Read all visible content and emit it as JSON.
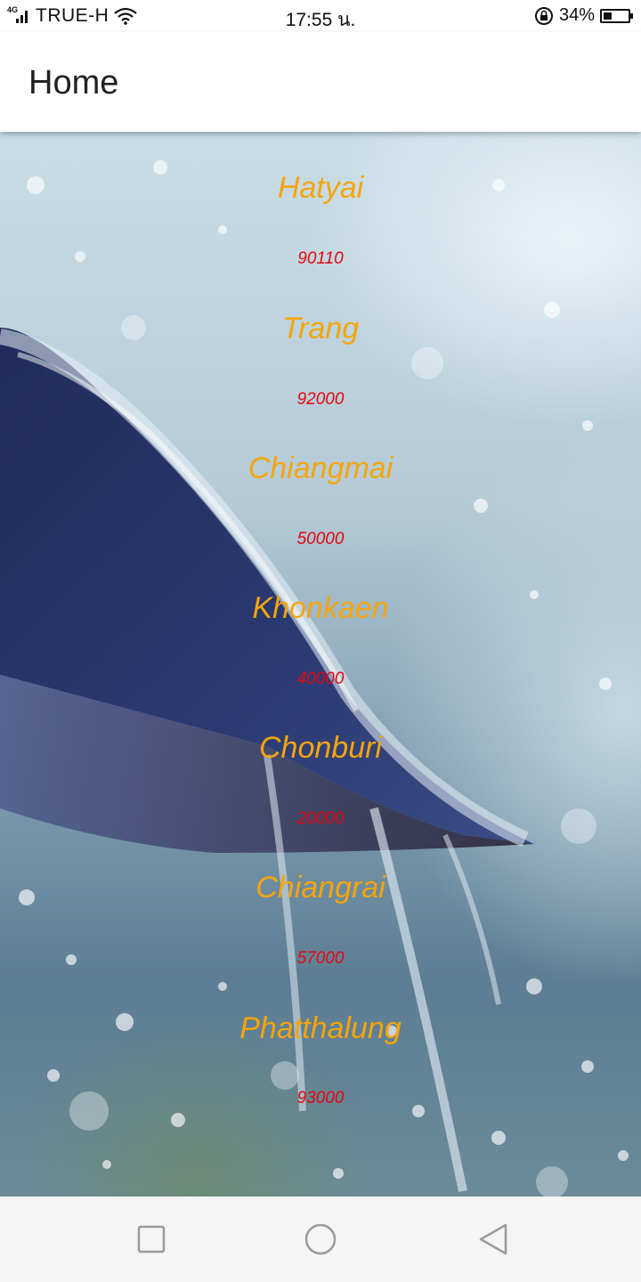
{
  "status_bar": {
    "network_type": "4G",
    "carrier": "TRUE-H",
    "time": "17:55 น.",
    "battery_percent": "34%",
    "battery_level": 0.34,
    "icons": [
      "signal-icon",
      "wifi-icon",
      "rotation-lock-icon",
      "battery-icon"
    ]
  },
  "app_bar": {
    "title": "Home"
  },
  "cities": [
    {
      "name": "Hatyai",
      "code": "90110"
    },
    {
      "name": "Trang",
      "code": "92000"
    },
    {
      "name": "Chiangmai",
      "code": "50000"
    },
    {
      "name": "Khonkaen",
      "code": "40000"
    },
    {
      "name": "Chonburi",
      "code": "20000"
    },
    {
      "name": "Chiangrai",
      "code": "57000"
    },
    {
      "name": "Phatthalung",
      "code": "93000"
    }
  ],
  "colors": {
    "city_name": "#f5a50a",
    "city_code": "#e5060f"
  },
  "nav_bar": {
    "icons": [
      "recent-apps-icon",
      "home-icon",
      "back-icon"
    ]
  }
}
